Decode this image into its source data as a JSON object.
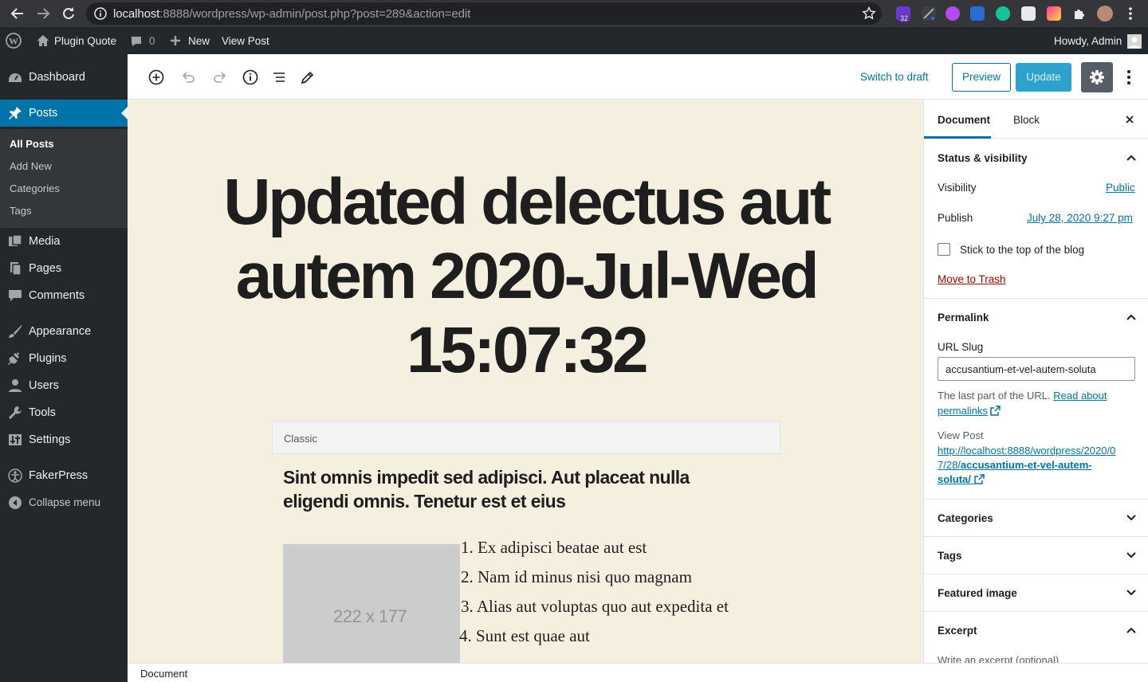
{
  "browser": {
    "url_host": "localhost",
    "url_path": ":8888/wordpress/wp-admin/post.php?post=289&action=edit",
    "ext_badge": "32"
  },
  "adminbar": {
    "site_name": "Plugin Quote",
    "comments_count": "0",
    "new_label": "New",
    "view_post_label": "View Post",
    "howdy": "Howdy, Admin"
  },
  "sidebar": {
    "items": [
      {
        "label": "Dashboard",
        "icon": "dashboard-icon"
      },
      {
        "label": "Posts",
        "icon": "pin-icon"
      },
      {
        "label": "Media",
        "icon": "media-icon"
      },
      {
        "label": "Pages",
        "icon": "pages-icon"
      },
      {
        "label": "Comments",
        "icon": "comment-icon"
      },
      {
        "label": "Appearance",
        "icon": "brush-icon"
      },
      {
        "label": "Plugins",
        "icon": "plug-icon"
      },
      {
        "label": "Users",
        "icon": "user-icon"
      },
      {
        "label": "Tools",
        "icon": "wrench-icon"
      },
      {
        "label": "Settings",
        "icon": "settings-icon"
      },
      {
        "label": "FakerPress",
        "icon": "fakerpress-icon"
      },
      {
        "label": "Collapse menu",
        "icon": "collapse-icon"
      }
    ],
    "submenu": [
      "All Posts",
      "Add New",
      "Categories",
      "Tags"
    ]
  },
  "toolbar": {
    "switch_to_draft": "Switch to draft",
    "preview": "Preview",
    "update": "Update"
  },
  "post": {
    "title": "Updated delectus aut autem 2020-Jul-Wed 15:07:32",
    "classic_label": "Classic",
    "heading": "Sint omnis impedit sed adipisci. Aut placeat nulla eligendi omnis. Tenetur est et eius",
    "image_placeholder": "222 x 177",
    "list": [
      {
        "num": "1.",
        "text": "Ex adipisci beatae aut est"
      },
      {
        "num": "2.",
        "text": "Nam id minus nisi quo magnam"
      },
      {
        "num": "3.",
        "text": "Alias aut voluptas quo aut expedita et"
      },
      {
        "num": "4.",
        "text": "Sunt est quae aut"
      }
    ]
  },
  "footer": {
    "breadcrumb": "Document"
  },
  "settings": {
    "tab_document": "Document",
    "tab_block": "Block",
    "status": {
      "title": "Status & visibility",
      "visibility_label": "Visibility",
      "visibility_value": "Public",
      "publish_label": "Publish",
      "publish_value": "July 28, 2020 9:27 pm",
      "sticky_label": "Stick to the top of the blog",
      "trash": "Move to Trash"
    },
    "permalink": {
      "title": "Permalink",
      "slug_label": "URL Slug",
      "slug_value": "accusantium-et-vel-autem-soluta",
      "help_text": "The last part of the URL.",
      "help_link_1": "Read about",
      "help_link_2": "permalinks",
      "view_post_label": "View Post",
      "view_url_1": "http://localhost:8888/wordpress/2020/0",
      "view_url_2": "7/28/",
      "view_url_2b": "accusantium-et-vel-autem-",
      "view_url_3": "soluta/"
    },
    "categories": "Categories",
    "tags": "Tags",
    "featured_image": "Featured image",
    "excerpt": "Excerpt",
    "excerpt_placeholder": "Write an excerpt (optional)"
  },
  "colors": {
    "accent": "#0073aa",
    "admin_bg": "#23282d",
    "canvas_bg": "#f5efe0",
    "trash": "#a00"
  }
}
